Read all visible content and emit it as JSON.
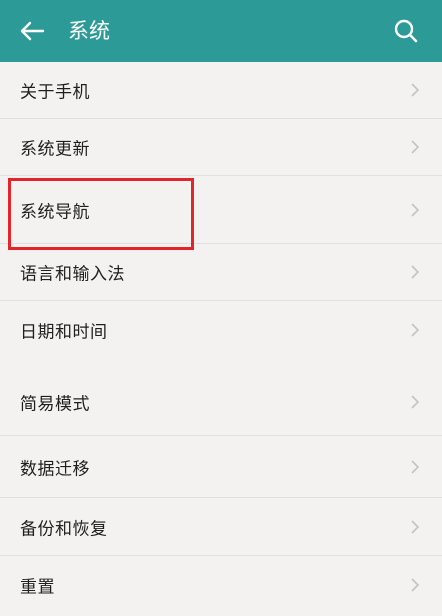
{
  "header": {
    "title": "系统",
    "back_icon": "arrow-left-icon",
    "search_icon": "search-icon",
    "background_color": "#2c9b97"
  },
  "settings": {
    "items": [
      {
        "label": "关于手机"
      },
      {
        "label": "系统更新"
      },
      {
        "label": "系统导航"
      },
      {
        "label": "语言和输入法"
      },
      {
        "label": "日期和时间"
      },
      {
        "label": "简易模式"
      },
      {
        "label": "数据迁移"
      },
      {
        "label": "备份和恢复"
      },
      {
        "label": "重置"
      }
    ],
    "chevron_icon": "chevron-right-icon"
  },
  "annotation": {
    "highlight_color": "#e2252b",
    "highlighted_item": "系统导航"
  }
}
